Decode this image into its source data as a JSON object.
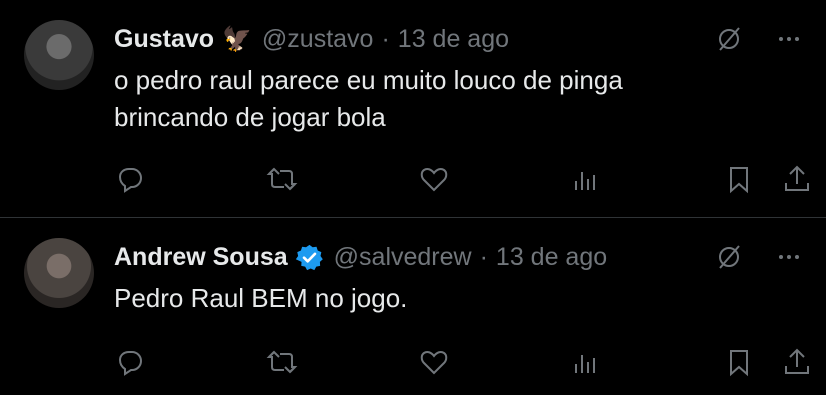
{
  "tweets": [
    {
      "name": "Gustavo",
      "badge": "🦅",
      "handle": "@zustavo",
      "separator": "·",
      "time": "13 de ago",
      "text": "o pedro raul parece eu muito louco de pinga brincando de jogar bola",
      "avatar_icon": "user-avatar"
    },
    {
      "name": "Andrew Sousa",
      "badge": "verified-badge-icon",
      "handle": "@salvedrew",
      "separator": "·",
      "time": "13 de ago",
      "text": "Pedro Raul BEM no jogo.",
      "avatar_icon": "user-avatar"
    }
  ],
  "icons": {
    "grok": "grok-icon",
    "more": "more-icon",
    "reply": "reply-icon",
    "repost": "repost-icon",
    "like": "like-icon",
    "views": "views-icon",
    "bookmark": "bookmark-icon",
    "share": "share-icon"
  },
  "colors": {
    "background": "#000000",
    "text": "#e7e9ea",
    "muted": "#71767b",
    "verified": "#1d9bf0",
    "divider": "#2f3336"
  }
}
